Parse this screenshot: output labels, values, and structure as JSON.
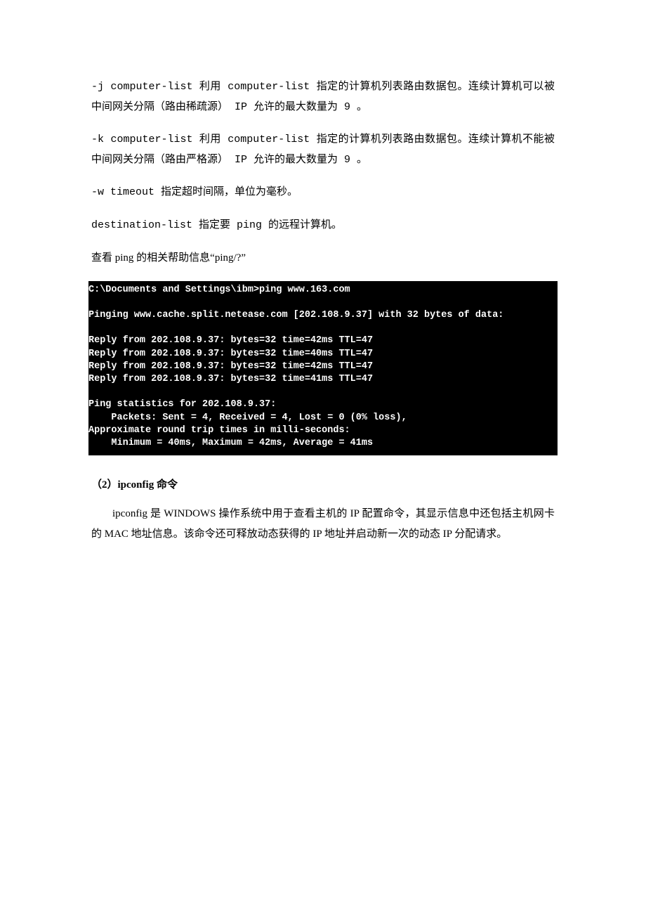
{
  "paragraphs": {
    "p1": "-j computer-list 利用 computer-list 指定的计算机列表路由数据包。连续计算机可以被中间网关分隔（路由稀疏源） IP 允许的最大数量为 9 。",
    "p2": "-k computer-list 利用 computer-list 指定的计算机列表路由数据包。连续计算机不能被中间网关分隔（路由严格源） IP 允许的最大数量为 9 。",
    "p3": "-w timeout 指定超时间隔，单位为毫秒。",
    "p4": "destination-list 指定要 ping 的远程计算机。",
    "p5": "查看 ping 的相关帮助信息“ping/?”"
  },
  "terminal": {
    "line1": "C:\\Documents and Settings\\ibm>ping www.163.com",
    "blank1": "",
    "line2": "Pinging www.cache.split.netease.com [202.108.9.37] with 32 bytes of data:",
    "blank2": "",
    "line3": "Reply from 202.108.9.37: bytes=32 time=42ms TTL=47",
    "line4": "Reply from 202.108.9.37: bytes=32 time=40ms TTL=47",
    "line5": "Reply from 202.108.9.37: bytes=32 time=42ms TTL=47",
    "line6": "Reply from 202.108.9.37: bytes=32 time=41ms TTL=47",
    "blank3": "",
    "line7": "Ping statistics for 202.108.9.37:",
    "line8": "    Packets: Sent = 4, Received = 4, Lost = 0 (0% loss),",
    "line9": "Approximate round trip times in milli-seconds:",
    "line10": "    Minimum = 40ms, Maximum = 42ms, Average = 41ms"
  },
  "heading": {
    "prefix": "（2）",
    "cmd": "ipconfig",
    "suffix": " 命令"
  },
  "body": {
    "seg1": "ipconfig 是 WINDOWS 操作系统中用于查看主机的 IP 配置命令，其显示信息中还包括主机网卡的 MAC 地址信息。该命令还可释放动态获得的 IP 地址并启动新一次的动态 IP 分配请求。"
  }
}
